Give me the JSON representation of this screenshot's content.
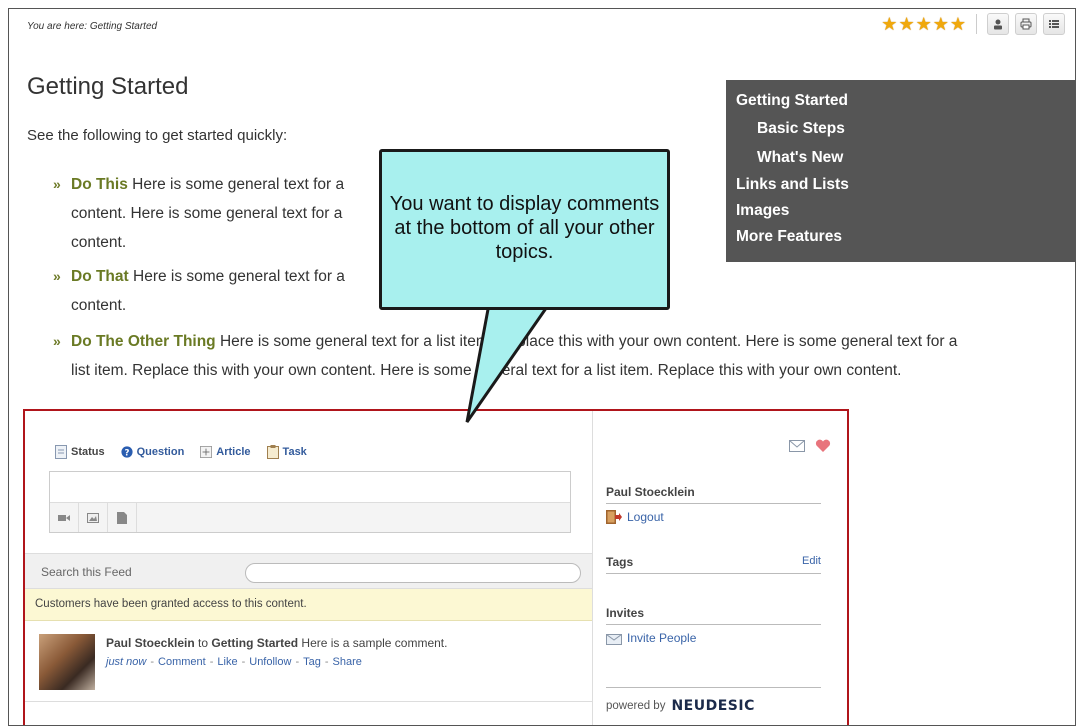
{
  "breadcrumb": "You are here: Getting Started",
  "toolbar": {
    "rating_stars": 5,
    "icons": [
      "user-icon",
      "print-icon",
      "toc-icon"
    ]
  },
  "page": {
    "title": "Getting Started",
    "intro": "See the following to get started quickly:",
    "items": [
      {
        "lead": "Do This",
        "line1": "Here is some general text for a",
        "line2": "content. Here is some general text for a",
        "line3": "content."
      },
      {
        "lead": "Do That",
        "line1": "Here is some general text for a",
        "line2": "content."
      },
      {
        "lead": "Do The Other Thing",
        "line1": "Here is some general text for a list item. Replace this with your own content. Here is some general text for a",
        "line2": "list item. Replace this with your own content. Here is some general text for a list item. Replace this with your own content."
      }
    ]
  },
  "toc": {
    "items": [
      "Getting Started",
      "Basic Steps",
      "What's New",
      "Links and Lists",
      "Images",
      "More Features"
    ]
  },
  "callout": {
    "text": "You want to display comments at the bottom of all your other topics.",
    "color": "#a8f0ee"
  },
  "widget": {
    "border_color": "#b0151b",
    "tabs": [
      "Status",
      "Question",
      "Article",
      "Task"
    ],
    "search_label": "Search this Feed",
    "notice": "Customers have been granted access to this content.",
    "comment": {
      "author": "Paul Stoecklein",
      "to_word": "to",
      "topic": "Getting Started",
      "body": "Here is a sample comment.",
      "time": "just now",
      "actions": [
        "Comment",
        "Like",
        "Unfollow",
        "Tag",
        "Share"
      ]
    },
    "user": {
      "name": "Paul Stoecklein",
      "logout": "Logout"
    },
    "tags": {
      "label": "Tags",
      "edit": "Edit"
    },
    "invites": {
      "label": "Invites",
      "link": "Invite People"
    },
    "powered_by": "powered by",
    "brand": "NEUDESIC"
  }
}
